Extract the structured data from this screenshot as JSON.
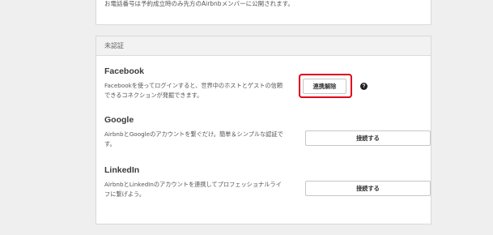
{
  "top_card": {
    "note": "お電話番号は予約成立時のみ先方のAirbnbメンバーに公開されます。"
  },
  "unverified": {
    "header": "未認証",
    "services": [
      {
        "name": "Facebook",
        "description": "Facebookを使ってログインすると、世界中のホストとゲストの信頼できるコネクションが発掘できます。",
        "button": "連携解除",
        "help_icon": "?"
      },
      {
        "name": "Google",
        "description": "AirbnbとGoogleのアカウントを繋ぐだけ。簡単＆シンプルな認証です。",
        "button": "接続する"
      },
      {
        "name": "LinkedIn",
        "description": "AirbnbとLinkedInのアカウントを連携してプロフェッショナルライフに繋げよう。",
        "button": "接続する"
      }
    ]
  },
  "colors": {
    "highlight": "#e0001a",
    "background": "#efefef"
  }
}
